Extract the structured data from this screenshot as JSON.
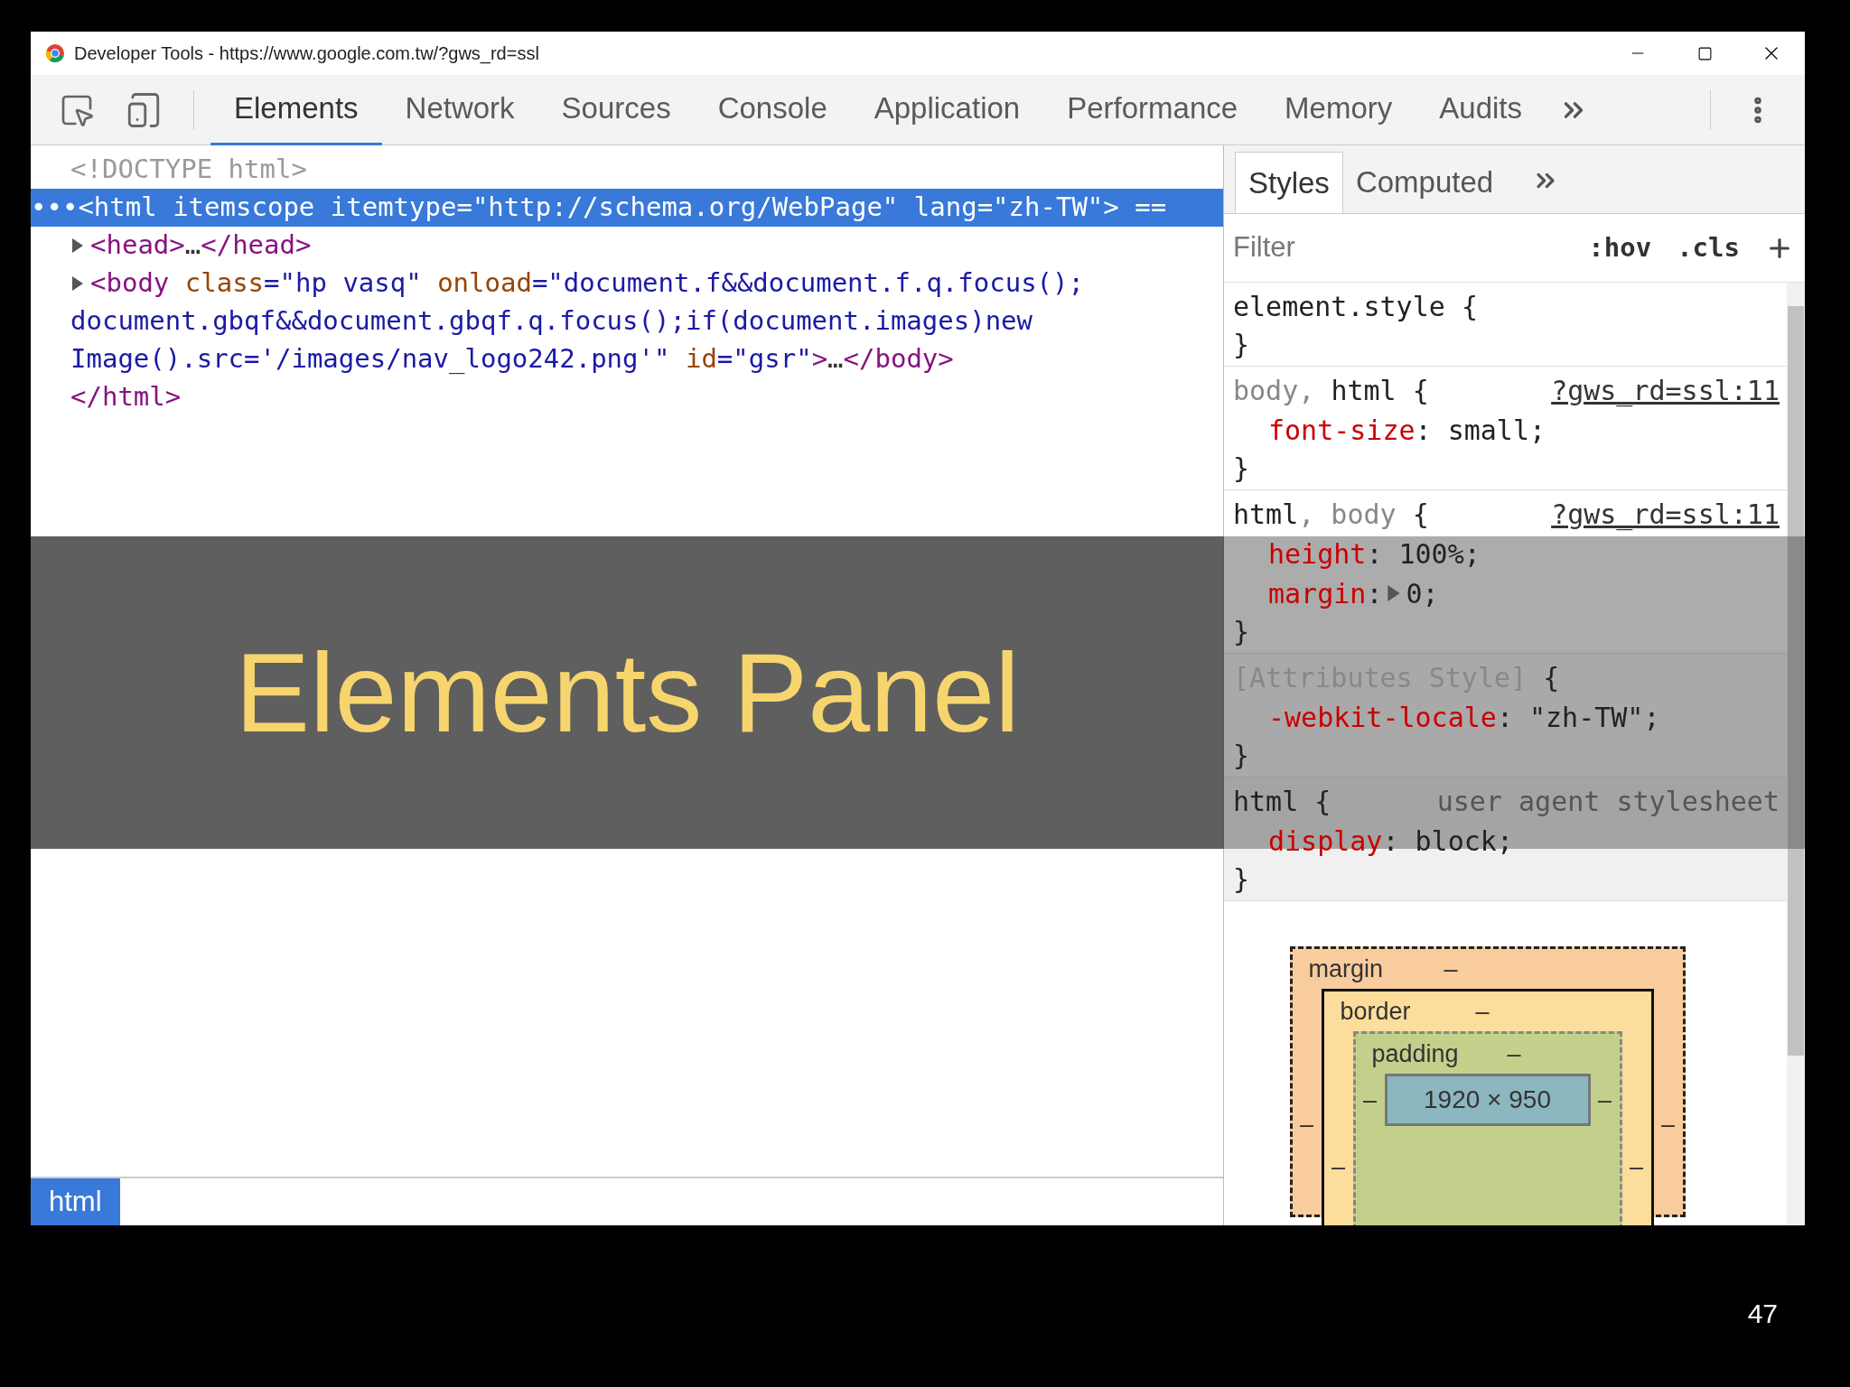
{
  "window": {
    "title": "Developer Tools - https://www.google.com.tw/?gws_rd=ssl"
  },
  "tabs": [
    {
      "label": "Elements",
      "selected": true
    },
    {
      "label": "Network",
      "selected": false
    },
    {
      "label": "Sources",
      "selected": false
    },
    {
      "label": "Console",
      "selected": false
    },
    {
      "label": "Application",
      "selected": false
    },
    {
      "label": "Performance",
      "selected": false
    },
    {
      "label": "Memory",
      "selected": false
    },
    {
      "label": "Audits",
      "selected": false
    }
  ],
  "dom_tree": [
    {
      "selected": false,
      "lines": [
        [
          {
            "kind": "doctype",
            "text": "<!DOCTYPE html>"
          }
        ]
      ]
    },
    {
      "selected": true,
      "prefix": "•••",
      "lines": [
        [
          {
            "kind": "tag",
            "text": "<html"
          },
          {
            "kind": "attr",
            "text": " itemscope itemtype"
          },
          {
            "kind": "value",
            "text": "=\"http://schema.org/WebPage\""
          },
          {
            "kind": "attr",
            "text": " lang"
          },
          {
            "kind": "value",
            "text": "=\"zh-TW\""
          },
          {
            "kind": "tag",
            "text": ">"
          },
          {
            "kind": "plain",
            "text": " =="
          }
        ]
      ],
      "children": [
        {
          "expanded": false,
          "selected": false,
          "lines": [
            [
              {
                "kind": "tag",
                "text": "<head>"
              },
              {
                "kind": "plain",
                "text": "…"
              },
              {
                "kind": "tag",
                "text": "</head>"
              }
            ]
          ]
        },
        {
          "expanded": false,
          "selected": false,
          "lines": [
            [
              {
                "kind": "tag",
                "text": "<body"
              },
              {
                "kind": "attr",
                "text": " class"
              },
              {
                "kind": "value",
                "text": "=\"hp vasq\""
              },
              {
                "kind": "attr",
                "text": " onload"
              },
              {
                "kind": "value",
                "text": "=\"document.f&&document.f.q.focus();"
              }
            ],
            [
              {
                "kind": "value",
                "text": "document.gbqf&&document.gbqf.q.focus();if(document.images)new"
              }
            ],
            [
              {
                "kind": "value",
                "text": "Image().src='/images/nav_logo242.png'\""
              },
              {
                "kind": "attr",
                "text": " id"
              },
              {
                "kind": "value",
                "text": "=\"gsr\""
              },
              {
                "kind": "tag",
                "text": ">"
              },
              {
                "kind": "plain",
                "text": "…"
              },
              {
                "kind": "tag",
                "text": "</body>"
              }
            ]
          ]
        }
      ],
      "closing": [
        {
          "kind": "tag",
          "text": "</html>"
        }
      ]
    }
  ],
  "breadcrumbs": [
    {
      "label": "html",
      "selected": true
    }
  ],
  "side_tabs": [
    {
      "label": "Styles",
      "selected": true
    },
    {
      "label": "Computed",
      "selected": false
    }
  ],
  "filter": {
    "placeholder": "Filter",
    "hov": ":hov",
    "cls": ".cls"
  },
  "rules": [
    {
      "kind": "inline",
      "selector": [
        {
          "text": "element.style",
          "matched": true
        }
      ],
      "open": "{",
      "close": "}"
    },
    {
      "kind": "author",
      "selector": [
        {
          "text": "body, ",
          "matched": false
        },
        {
          "text": "html",
          "matched": true
        }
      ],
      "open": "{",
      "source": "?gws_rd=ssl:11",
      "declarations": [
        {
          "property": "font-size",
          "colon": ":",
          "value": "small",
          "semicolon": ";",
          "expandable": false
        }
      ],
      "close": "}"
    },
    {
      "kind": "author",
      "selector": [
        {
          "text": "html",
          "matched": true
        },
        {
          "text": ", body",
          "matched": false
        }
      ],
      "open": "{",
      "source": "?gws_rd=ssl:11",
      "declarations": [
        {
          "property": "height",
          "colon": ":",
          "value": "100%",
          "semicolon": ";",
          "expandable": false
        },
        {
          "property": "margin",
          "colon": ":",
          "value": "0",
          "semicolon": ";",
          "expandable": true
        }
      ],
      "close": "}"
    },
    {
      "kind": "attributes",
      "selector": [
        {
          "text": "[Attributes Style]",
          "matched": false
        }
      ],
      "open": "{",
      "declarations": [
        {
          "property": "-webkit-locale",
          "colon": ":",
          "value": "\"zh-TW\"",
          "semicolon": ";",
          "expandable": false
        }
      ],
      "close": "}"
    },
    {
      "kind": "user-agent",
      "selector": [
        {
          "text": "html",
          "matched": true
        }
      ],
      "open": "{",
      "source": "user agent stylesheet",
      "declarations": [
        {
          "property": "display",
          "colon": ":",
          "value": "block",
          "semicolon": ";",
          "expandable": false
        }
      ],
      "close": "}"
    }
  ],
  "box_model": {
    "margin": {
      "label": "margin",
      "top": "–",
      "left": "–",
      "right": "–"
    },
    "border": {
      "label": "border",
      "top": "–",
      "left": "–",
      "right": "–"
    },
    "padding": {
      "label": "padding",
      "top": "–",
      "left": "–",
      "right": "–"
    },
    "content": "1920 × 950"
  },
  "slide": {
    "title": "Elements Panel",
    "page_number": "47"
  }
}
